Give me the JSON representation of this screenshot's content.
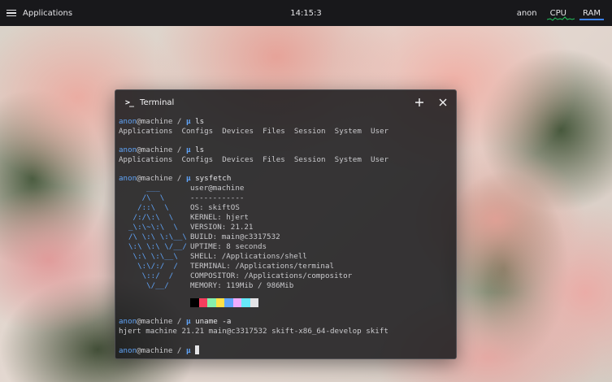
{
  "panel": {
    "apps_label": "Applications",
    "clock": "14:15:3",
    "user": "anon",
    "cpu_label": "CPU",
    "ram_label": "RAM"
  },
  "window": {
    "title": "Terminal",
    "icon": "terminal-icon",
    "add_icon": "plus-icon",
    "close_icon": "close-icon"
  },
  "terminal": {
    "prompt_user": "anon",
    "prompt_host": "@machine / ",
    "prompt_mu": "µ",
    "commands": [
      "ls",
      "ls",
      "sysfetch",
      "uname -a"
    ],
    "ls_output": [
      "Applications",
      "Configs",
      "Devices",
      "Files",
      "Session",
      "System",
      "User"
    ],
    "ascii_art": [
      "    ___",
      "   /\\  \\",
      "  /::\\  \\",
      " /:/\\:\\  \\",
      "_\\:\\~\\:\\  \\",
      "/\\ \\:\\ \\:\\__\\",
      "\\:\\ \\:\\ \\/__/",
      " \\:\\ \\:\\__\\",
      "  \\:\\/:/  /",
      "   \\::/  /",
      "    \\/__/"
    ],
    "sysinfo": [
      "user@machine",
      "------------",
      "OS: skiftOS",
      "KERNEL: hjert",
      "VERSION: 21.21",
      "BUILD: main@c3317532",
      "UPTIME: 8 seconds",
      "SHELL: /Applications/shell",
      "TERMINAL: /Applications/terminal",
      "COMPOSITOR: /Applications/compositor",
      "MEMORY: 119Mib / 986Mib"
    ],
    "palette_colors": [
      "#000000",
      "#f43f5e",
      "#86efac",
      "#fde047",
      "#60a5fa",
      "#f0abfc",
      "#67e8f9",
      "#e4e4e7"
    ],
    "uname_output": "hjert machine 21.21 main@c3317532 skift-x86_64-develop skift"
  },
  "colors": {
    "panel_bg": "#18181b",
    "accent_blue": "#3b82f6",
    "cpu_graph": "#22c55e"
  }
}
